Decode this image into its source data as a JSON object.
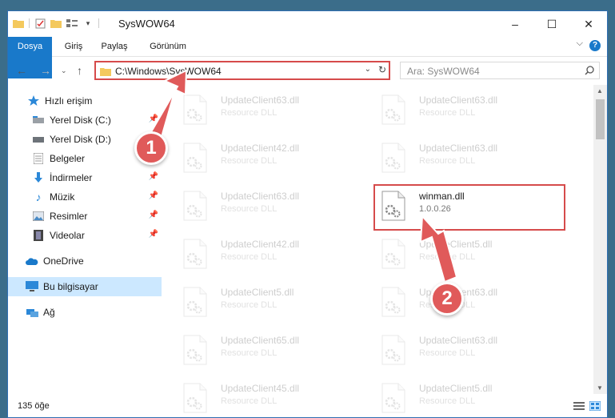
{
  "window": {
    "title": "SysWOW64",
    "minimize": "–",
    "maximize": "☐",
    "close": "✕"
  },
  "ribbon": {
    "tabs": [
      "Dosya",
      "Giriş",
      "Paylaş",
      "Görünüm"
    ],
    "help": "?",
    "collapse": "⌵"
  },
  "address": {
    "path": "C:\\Windows\\SysWOW64",
    "search_placeholder": "Ara: SysWOW64"
  },
  "nav": {
    "quick_access": "Hızlı erişim",
    "items": [
      {
        "label": "Yerel Disk (C:)",
        "icon": "drive-icon"
      },
      {
        "label": "Yerel Disk (D:)",
        "icon": "drive-icon"
      },
      {
        "label": "Belgeler",
        "icon": "documents-icon"
      },
      {
        "label": "İndirmeler",
        "icon": "download-icon"
      },
      {
        "label": "Müzik",
        "icon": "music-icon"
      },
      {
        "label": "Resimler",
        "icon": "pictures-icon"
      },
      {
        "label": "Videolar",
        "icon": "video-icon"
      }
    ],
    "onedrive": "OneDrive",
    "this_pc": "Bu bilgisayar",
    "network": "Ağ"
  },
  "files": [
    {
      "name": "UpdateClient63.dll",
      "sub": "Resource DLL"
    },
    {
      "name": "UpdateClient63.dll",
      "sub": "Resource DLL"
    },
    {
      "name": "UpdateClient42.dll",
      "sub": "Resource DLL"
    },
    {
      "name": "UpdateClient63.dll",
      "sub": "Resource DLL"
    },
    {
      "name": "UpdateClient63.dll",
      "sub": "Resource DLL"
    },
    {
      "name": "winman.dll",
      "sub": "1.0.0.26"
    },
    {
      "name": "UpdateClient42.dll",
      "sub": "Resource DLL"
    },
    {
      "name": "UpdateClient5.dll",
      "sub": "Resource DLL"
    },
    {
      "name": "UpdateClient5.dll",
      "sub": "Resource DLL"
    },
    {
      "name": "UpdateClient63.dll",
      "sub": "Resource DLL"
    },
    {
      "name": "UpdateClient65.dll",
      "sub": "Resource DLL"
    },
    {
      "name": "UpdateClient63.dll",
      "sub": "Resource DLL"
    },
    {
      "name": "UpdateClient45.dll",
      "sub": "Resource DLL"
    },
    {
      "name": "UpdateClient5.dll",
      "sub": "Resource DLL"
    }
  ],
  "status": {
    "count": "135 öğe"
  },
  "annotations": {
    "step1": "1",
    "step2": "2"
  },
  "colors": {
    "accent": "#1979ca",
    "highlight": "#d64b4b",
    "bubble": "#e05a5a",
    "selection": "#cce8ff"
  }
}
